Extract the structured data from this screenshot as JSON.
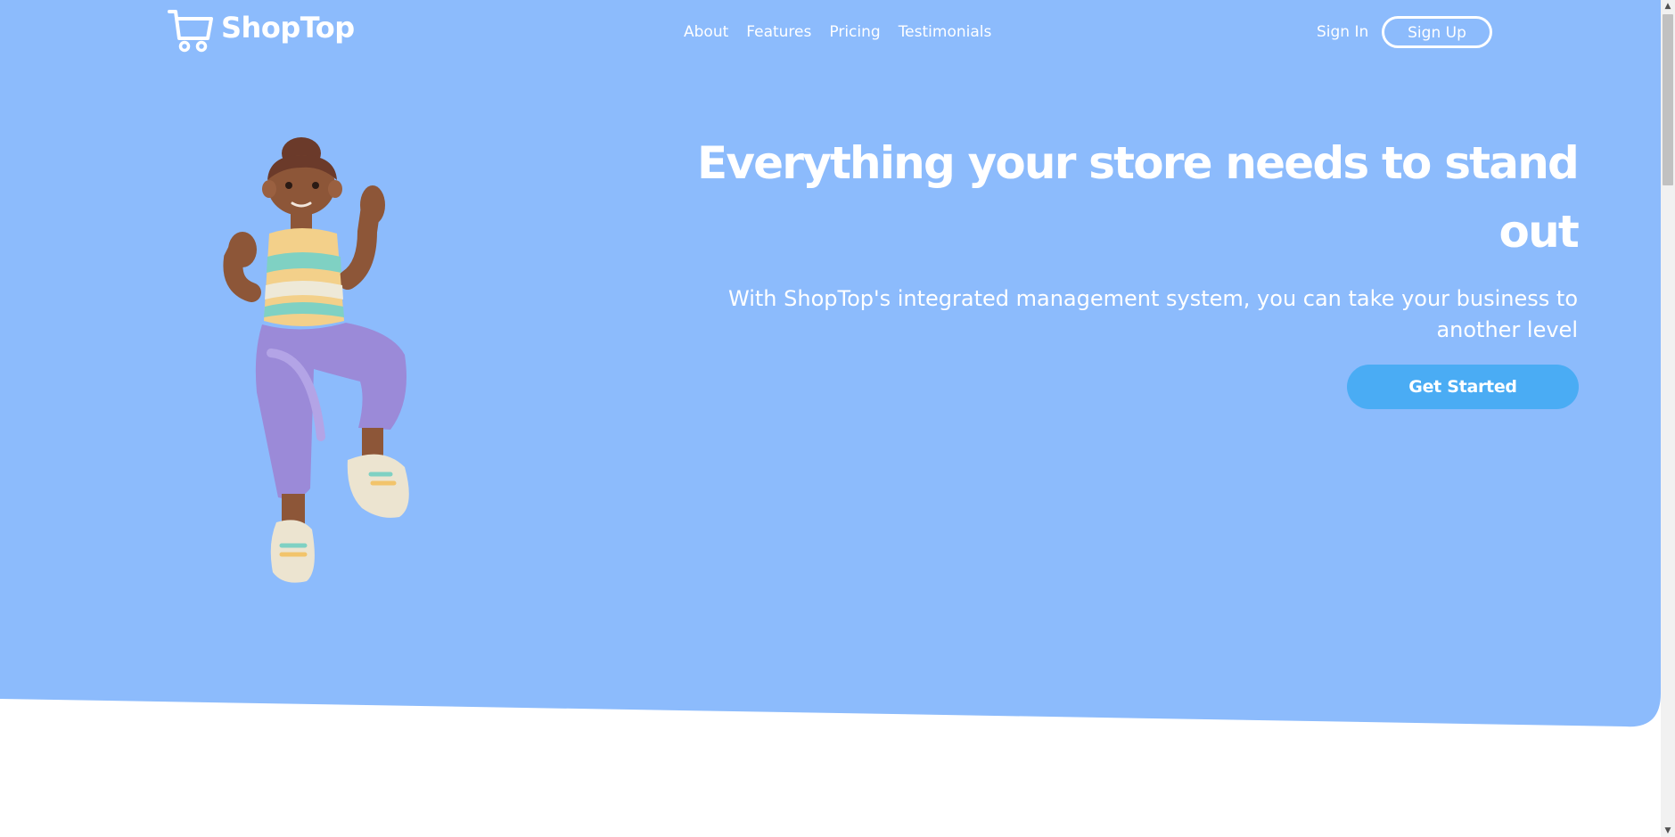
{
  "header": {
    "brand": "ShopTop",
    "logo_icon": "shopping-cart-icon",
    "nav": [
      "About",
      "Features",
      "Pricing",
      "Testimonials"
    ],
    "sign_in": "Sign In",
    "sign_up": "Sign Up"
  },
  "hero": {
    "title": "Everything your store needs to stand out",
    "subtitle": "With ShopTop's integrated management system, you can take your business to another level",
    "cta": "Get Started",
    "illustration": "3d-character-illustration"
  },
  "scrollbar": {
    "up_icon": "scroll-up-arrow-icon",
    "down_icon": "scroll-down-arrow-icon",
    "up_glyph": "▲",
    "down_glyph": "▼"
  },
  "colors": {
    "hero_background": "#8cbbfc",
    "button": "#4aacf4",
    "text": "#ffffff",
    "page_background": "#ffffff"
  }
}
